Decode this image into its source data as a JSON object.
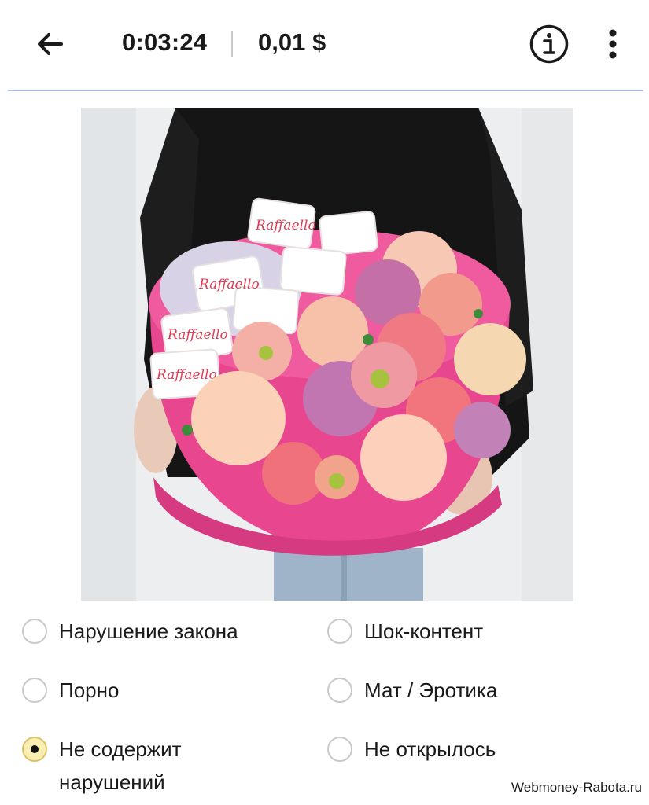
{
  "header": {
    "timer": "0:03:24",
    "price": "0,01 $",
    "back_icon": "arrow-left-icon",
    "info_icon": "info-circle-icon",
    "more_icon": "more-vertical-icon"
  },
  "content_image": {
    "subject": "hat box with flowers and raffaello candies",
    "candy_label": "Raffaello"
  },
  "options": [
    {
      "label": "Нарушение закона",
      "checked": false
    },
    {
      "label": "Шок-контент",
      "checked": false
    },
    {
      "label": "Порно",
      "checked": false
    },
    {
      "label": "Мат / Эротика",
      "checked": false
    },
    {
      "label": "Не содержит\nнарушений",
      "checked": true
    },
    {
      "label": "Не открылось",
      "checked": false
    }
  ],
  "watermark": "Webmoney-Rabota.ru",
  "colors": {
    "accent_divider": "#aeb8e4",
    "selected_radio_fill": "#fbeeb2",
    "box_pink": "#e8468f"
  }
}
